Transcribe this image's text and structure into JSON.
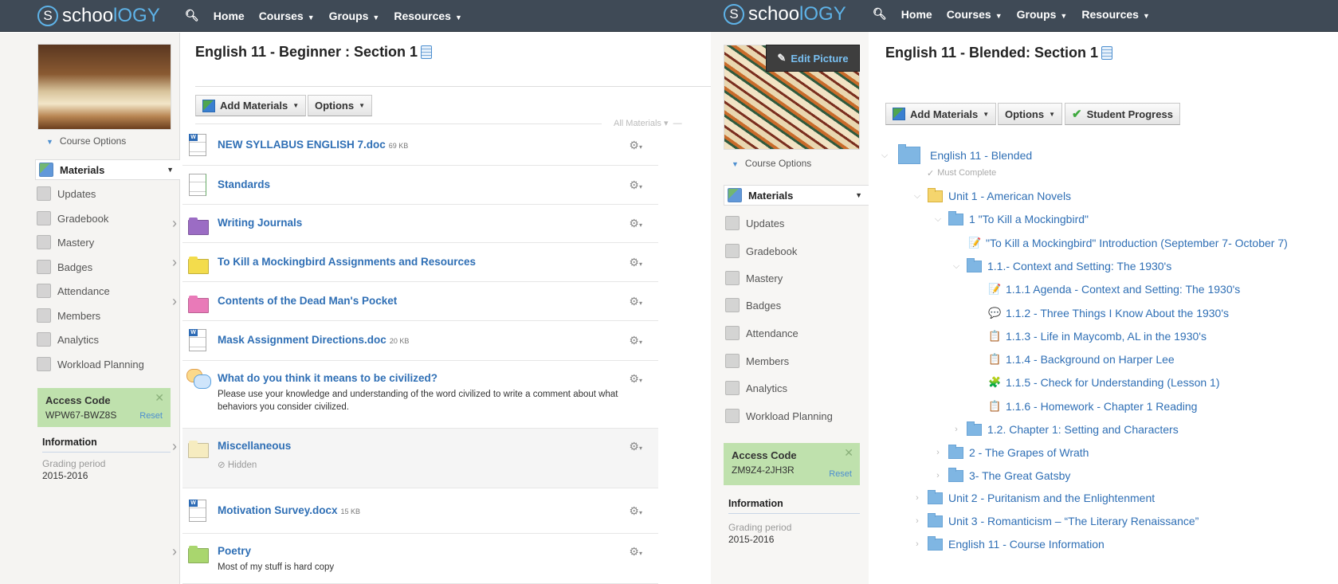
{
  "nav": {
    "logo": "schoology",
    "items": [
      "Home",
      "Courses",
      "Groups",
      "Resources"
    ]
  },
  "left": {
    "course_options": "Course Options",
    "sidebar": [
      "Materials",
      "Updates",
      "Gradebook",
      "Mastery",
      "Badges",
      "Attendance",
      "Members",
      "Analytics",
      "Workload Planning"
    ],
    "access": {
      "title": "Access Code",
      "code": "WPW67-BWZ8S",
      "reset": "Reset"
    },
    "info": {
      "title": "Information",
      "grading_label": "Grading period",
      "grading_value": "2015-2016"
    },
    "title": "English 11 - Beginner : Section 1",
    "buttons": {
      "add": "Add Materials",
      "options": "Options"
    },
    "filter": "All Materials",
    "materials": [
      {
        "type": "doc",
        "title": "NEW SYLLABUS ENGLISH 7.doc",
        "size": "69 KB"
      },
      {
        "type": "page",
        "title": "Standards"
      },
      {
        "type": "folder",
        "color": "#9b6cc4",
        "title": "Writing Journals"
      },
      {
        "type": "folder",
        "color": "#f3dc4c",
        "title": "To Kill a Mockingbird Assignments and Resources"
      },
      {
        "type": "folder",
        "color": "#e97ab8",
        "title": "Contents of the Dead Man's Pocket"
      },
      {
        "type": "doc",
        "title": "Mask Assignment Directions.doc",
        "size": "20 KB"
      },
      {
        "type": "discussion",
        "title": "What do you think it means to be civilized?",
        "desc": "Please use your knowledge and understanding of the word civilized to write a comment about what behaviors you consider civilized."
      },
      {
        "type": "folder",
        "color": "#f6ecc0",
        "title": "Miscellaneous",
        "status": "Hidden"
      },
      {
        "type": "doc",
        "title": "Motivation Survey.docx",
        "size": "15 KB"
      },
      {
        "type": "folder",
        "color": "#a9d66e",
        "title": "Poetry",
        "desc": "Most of my stuff is hard copy"
      }
    ]
  },
  "right": {
    "edit_picture": "Edit Picture",
    "course_options": "Course Options",
    "sidebar": [
      "Materials",
      "Updates",
      "Gradebook",
      "Mastery",
      "Badges",
      "Attendance",
      "Members",
      "Analytics",
      "Workload Planning"
    ],
    "access": {
      "title": "Access Code",
      "code": "ZM9Z4-2JH3R",
      "reset": "Reset"
    },
    "info": {
      "title": "Information",
      "grading_label": "Grading period",
      "grading_value": "2015-2016"
    },
    "title": "English 11 - Blended: Section 1",
    "buttons": {
      "add": "Add Materials",
      "options": "Options",
      "progress": "Student Progress"
    },
    "tree": [
      {
        "level": 0,
        "kind": "bigfolder",
        "label": "English 11 - Blended",
        "expanded": true
      },
      {
        "level": 0,
        "kind": "note",
        "label": "Must Complete"
      },
      {
        "level": 1,
        "kind": "goldfolder",
        "label": "Unit 1 - American Novels",
        "expanded": true
      },
      {
        "level": 2,
        "kind": "folder",
        "label": "1 \"To Kill a Mockingbird\"",
        "expanded": true
      },
      {
        "level": 3,
        "kind": "page",
        "label": "\"To Kill a Mockingbird\" Introduction (September 7- October 7)"
      },
      {
        "level": 3,
        "kind": "folder",
        "label": "1.1.- Context and Setting: The 1930's",
        "expanded": true
      },
      {
        "level": 4,
        "kind": "page",
        "label": "1.1.1 Agenda - Context and Setting: The 1930's"
      },
      {
        "level": 4,
        "kind": "discussion",
        "label": "1.1.2 - Three Things I Know About the 1930's"
      },
      {
        "level": 4,
        "kind": "assignment",
        "label": "1.1.3 - Life in Maycomb, AL in the 1930's"
      },
      {
        "level": 4,
        "kind": "assignment",
        "label": "1.1.4 - Background on Harper Lee"
      },
      {
        "level": 4,
        "kind": "assessment",
        "label": "1.1.5 - Check for Understanding (Lesson 1)"
      },
      {
        "level": 4,
        "kind": "assignment",
        "label": "1.1.6 - Homework - Chapter 1 Reading"
      },
      {
        "level": 3,
        "kind": "folder",
        "label": "1.2. Chapter 1: Setting and Characters",
        "expanded": false
      },
      {
        "level": 2,
        "kind": "folder",
        "label": "2 - The Grapes of Wrath",
        "expanded": false
      },
      {
        "level": 2,
        "kind": "folder",
        "label": "3- The Great Gatsby",
        "expanded": false
      },
      {
        "level": 1,
        "kind": "folder",
        "label": "Unit 2 - Puritanism and the Enlightenment",
        "expanded": false
      },
      {
        "level": 1,
        "kind": "folder",
        "label": "Unit 3 - Romanticism – “The Literary Renaissance”",
        "expanded": false
      },
      {
        "level": 1,
        "kind": "folder",
        "label": "English 11 - Course Information",
        "expanded": false
      }
    ]
  }
}
